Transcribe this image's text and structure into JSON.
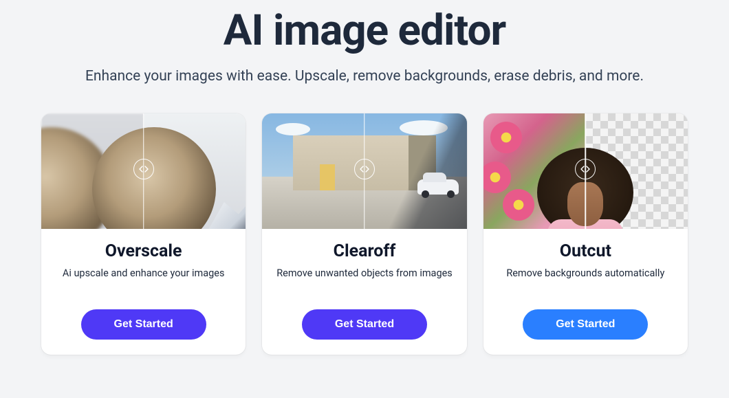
{
  "hero": {
    "title": "AI image editor",
    "subtitle": "Enhance your images with ease. Upscale, remove backgrounds, erase debris, and more."
  },
  "cards": [
    {
      "title": "Overscale",
      "desc": "Ai upscale and enhance your images",
      "cta": "Get Started"
    },
    {
      "title": "Clearoff",
      "desc": "Remove unwanted objects from images",
      "cta": "Get Started"
    },
    {
      "title": "Outcut",
      "desc": "Remove backgrounds automatically",
      "cta": "Get Started"
    }
  ],
  "colors": {
    "primary": "#4f39f6",
    "primary_alt": "#2a7fff",
    "text": "#1e293b"
  }
}
